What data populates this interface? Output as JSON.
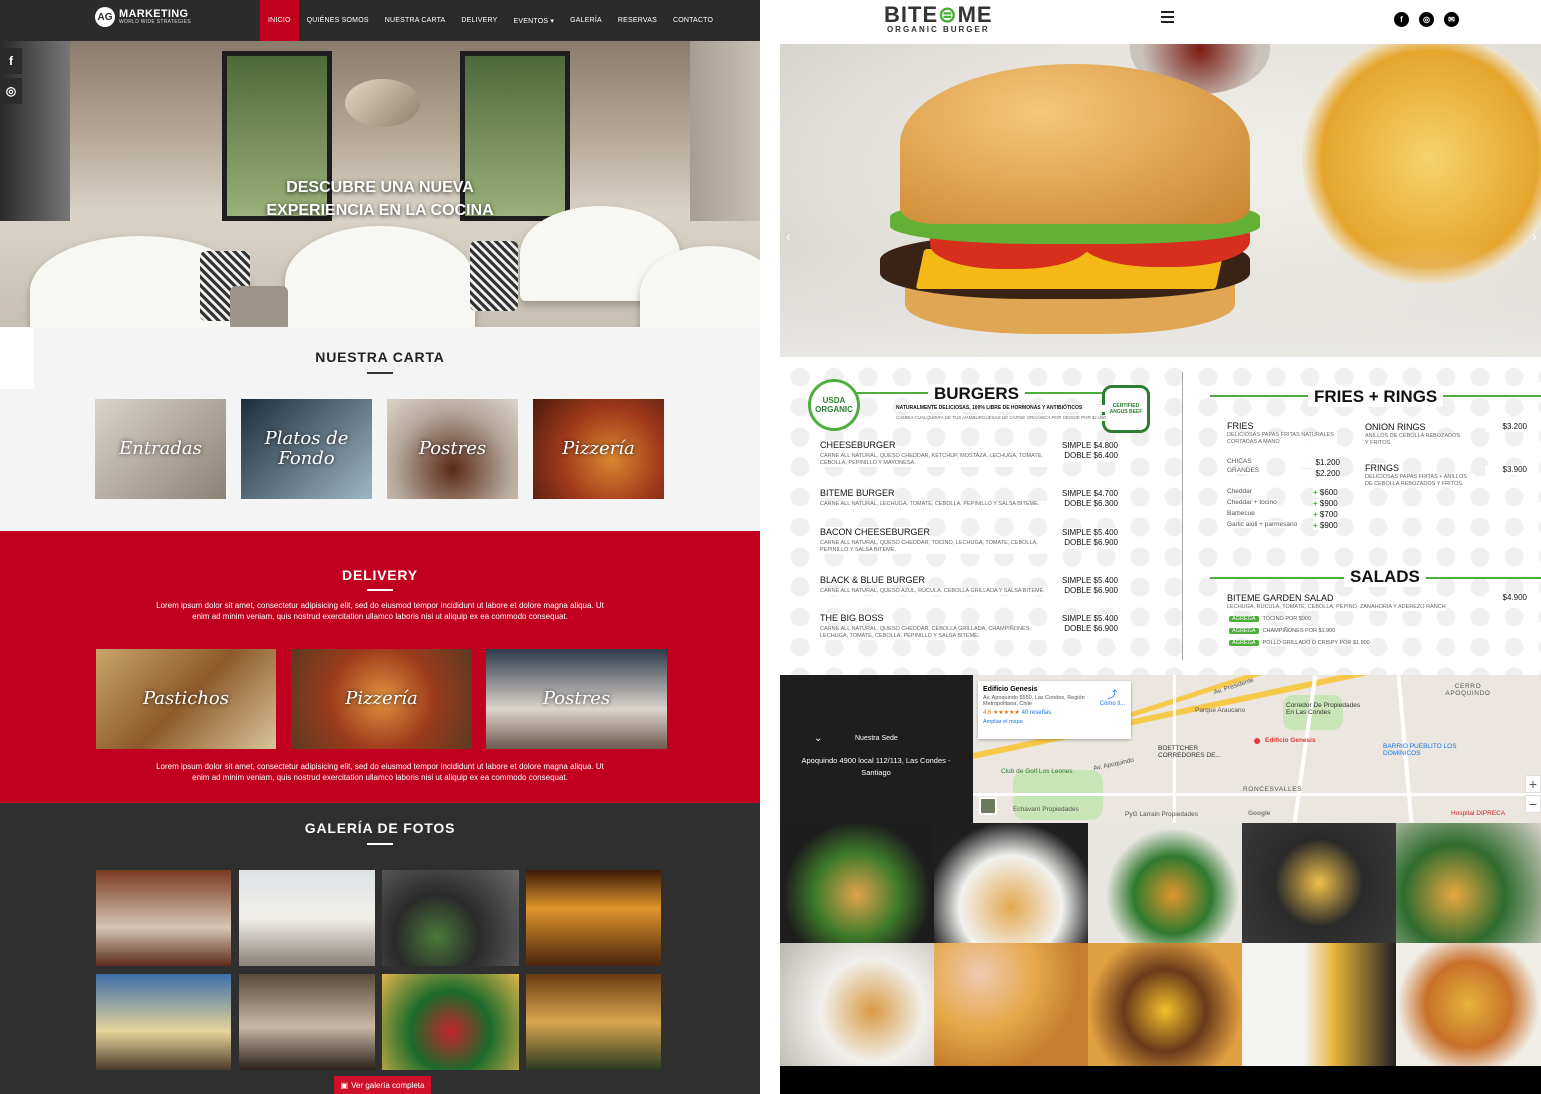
{
  "left_site": {
    "logo": {
      "mark": "AG",
      "title": "MARKETING",
      "subtitle": "WORLD WIDE STRATEGIES"
    },
    "menu": [
      {
        "label": "INICIO",
        "active": true
      },
      {
        "label": "QUIÉNES SOMOS"
      },
      {
        "label": "NUESTRA CARTA"
      },
      {
        "label": "DELIVERY"
      },
      {
        "label": "EVENTOS ▾"
      },
      {
        "label": "GALERÍA"
      },
      {
        "label": "RESERVAS"
      },
      {
        "label": "CONTACTO"
      }
    ],
    "social": [
      "f",
      "◎"
    ],
    "hero": {
      "line1": "DESCUBRE UNA NUEVA",
      "line2": "EXPERIENCIA EN LA COCINA"
    },
    "carta": {
      "title": "NUESTRA CARTA",
      "cards": [
        "Entradas",
        "Platos de Fondo",
        "Postres",
        "Pizzería"
      ]
    },
    "delivery": {
      "title": "DELIVERY",
      "intro": "Lorem ipsum dolor sit amet, consectetur adipisicing elit, sed do eiusmod tempor incididunt ut labore et dolore magna aliqua. Ut enim ad minim veniam, quis nostrud exercitation ullamco laboris nisi ut aliquip ex ea commodo consequat.",
      "cards": [
        "Pastichos",
        "Pizzería",
        "Postres"
      ],
      "outro": "Lorem ipsum dolor sit amet, consectetur adipisicing elit, sed do eiusmod tempor incididunt ut labore et dolore magna aliqua. Ut enim ad minim veniam, quis nostrud exercitation ullamco laboris nisi ut aliquip ex ea commodo consequat."
    },
    "gallery": {
      "title": "GALERÍA DE FOTOS",
      "button": "Ver galería completa"
    },
    "colors": {
      "accent": "#c1001f",
      "dark": "#2b2b2b"
    }
  },
  "right_site": {
    "logo": {
      "brand_a": "BITE",
      "brand_b": "ME",
      "tagline": "ORGANIC BURGER"
    },
    "social": [
      "f",
      "◎",
      "✉"
    ],
    "burgers": {
      "title": "BURGERS",
      "badge_usda": "USDA ORGANIC",
      "badge_angus": "CERTIFIED ANGUS BEEF",
      "subtitle": "NATURALMENTE DELICIOSAS, 100% LIBRE DE HORMONAS Y ANTIBIÓTICOS",
      "note": "CAMBIA CUALQUIERA DE TUS HAMBURGUESAS DE CARNE ORGÁNICA POR VEGGIE POR $1.000",
      "items": [
        {
          "name": "CHEESEBURGER",
          "desc": "CARNE ALL NATURAL, QUESO CHEDDAR, KETCHUP, MOSTAZA, LECHUGA, TOMATE, CEBOLLA, PEPINILLO Y MAYONESA.",
          "simple": "SIMPLE $4.800",
          "doble": "DOBLE $6.400"
        },
        {
          "name": "BITEME BURGER",
          "desc": "CARNE ALL NATURAL, LECHUGA, TOMATE, CEBOLLA, PEPINILLO Y SALSA BITEME.",
          "simple": "SIMPLE $4.700",
          "doble": "DOBLE $6.300"
        },
        {
          "name": "BACON CHEESEBURGER",
          "desc": "CARNE ALL NATURAL, QUESO CHEDDAR, TOCINO, LECHUGA, TOMATE, CEBOLLA, PEPINILLO Y SALSA BITEME.",
          "simple": "SIMPLE $5.400",
          "doble": "DOBLE $6.900"
        },
        {
          "name": "BLACK & BLUE BURGER",
          "desc": "CARNE ALL NATURAL, QUESO AZUL, RÚCULA, CEBOLLA GRILLADA Y SALSA BITEME.",
          "simple": "SIMPLE $5.400",
          "doble": "DOBLE $6.900"
        },
        {
          "name": "THE BIG BOSS",
          "desc": "CARNE ALL NATURAL, QUESO CHEDDAR, CEBOLLA GRILLADA, CHAMPIÑONES, LECHUGA, TOMATE, CEBOLLA, PEPINILLO Y SALSA BITEME.",
          "simple": "SIMPLE $5.400",
          "doble": "DOBLE $6.900"
        }
      ]
    },
    "fries": {
      "title": "FRIES + RINGS",
      "fries_name": "FRIES",
      "fries_desc": "DELICIOSAS PAPAS FRITAS NATURALES CORTADAS A MANO",
      "chicas": "CHICAS",
      "chicas_price": "$1.200",
      "grandes": "GRANDES",
      "grandes_price": "$2.200",
      "extras": [
        {
          "name": "Cheddar",
          "price": "$600"
        },
        {
          "name": "Cheddar + tocino",
          "price": "$900"
        },
        {
          "name": "Barbecue",
          "price": "$700"
        },
        {
          "name": "Garlic aioli + parmesano",
          "price": "$900"
        }
      ],
      "onion_name": "ONION RINGS",
      "onion_desc": "ANILLOS DE CEBOLLA REBOZADOS Y FRITOS.",
      "onion_price": "$3.200",
      "frings_name": "FRINGS",
      "frings_desc": "DELICIOSAS PAPAS FRITAS + ANILLOS DE CEBOLLA REBOZADOS Y FRITOS.",
      "frings_price": "$3.900"
    },
    "salads": {
      "title": "SALADS",
      "name": "BITEME GARDEN SALAD",
      "desc": "LECHUGA, RÚCULA, TOMATE, CEBOLLA, PEPINO, ZANAHORIA Y ADEREZO RANCH",
      "price": "$4.900",
      "add_label": "AGREGA",
      "adds": [
        "TOCINO POR $900",
        "CHAMPIÑONES POR $1.900",
        "POLLO GRILLADO O CRISPY POR $1.900"
      ]
    },
    "location": {
      "label": "Nuestra Sede",
      "address": "Apoquindo 4900 local 112/113, Las Condes - Santiago"
    },
    "map": {
      "place": "Edificio Genesis",
      "place_address": "Av. Apoquindo 6550, Las Condes, Región Metropolitana, Chile",
      "rating": "4,6 ★★★★★",
      "reviews": "40 reseñas",
      "directions": "Cómo ll...",
      "enlarge": "Ampliar el mapa",
      "pin_label": "Edificio Genesis",
      "labels": [
        "Av. Presidente",
        "Parque Araucano",
        "Corredor De Propiedades En Las Condes",
        "CERRO APOQUINDO",
        "BOETTCHER CORREDORES DE...",
        "BARRIO PUEBLITO LOS DOMINICOS",
        "Club de Golf Los Leones",
        "RONCESVALLES",
        "Av. Apoquindo",
        "Echavarri Propiedades",
        "PyG Larrain Propiedades",
        "Hospital DIPRECA",
        "Google"
      ]
    }
  }
}
